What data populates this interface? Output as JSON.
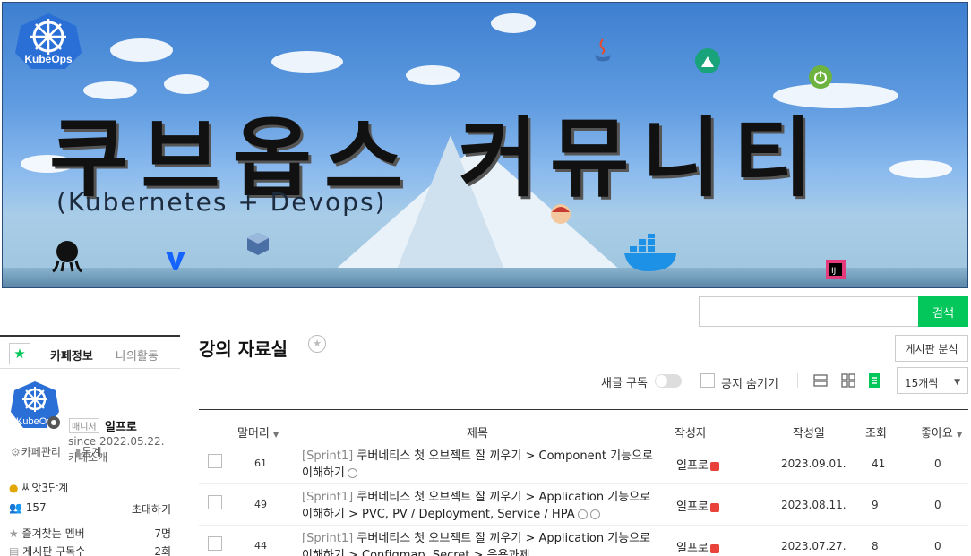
{
  "banner": {
    "logo_text": "KubeOps",
    "title": "쿠브옵스 커뮤니티",
    "subtitle": "(Kubernetes + Devops)"
  },
  "search": {
    "placeholder": "",
    "button": "검색"
  },
  "sidebar": {
    "tab_info": "카페정보",
    "tab_activity": "나의활동",
    "manager_badge": "매니저",
    "manager_name": "일프로",
    "since": "since 2022.05.22.",
    "cafe_intro": "카페소개",
    "cafe_manage": "카페관리",
    "stats_link": "통계",
    "level": "씨앗3단계",
    "members": "157",
    "invite": "초대하기",
    "fav_members_label": "즐겨찾는 멤버",
    "fav_members_value": "7명",
    "board_subs_label": "게시판 구독수",
    "board_subs_value": "2회"
  },
  "main": {
    "board_title": "강의 자료실",
    "analysis_button": "게시판 분석",
    "subscribe_label": "새글 구독",
    "hide_notice_label": "공지 숨기기",
    "per_page": "15개씩",
    "columns": {
      "header": "말머리",
      "title": "제목",
      "author": "작성자",
      "date": "작성일",
      "views": "조회",
      "likes": "좋아요"
    },
    "rows": [
      {
        "num": "61",
        "tag": "[Sprint1]",
        "title": "쿠버네티스 첫 오브젝트 잘 끼우기 > Component 기능으로 이해하기",
        "author": "일프로",
        "date": "2023.09.01.",
        "views": "41",
        "likes": "0"
      },
      {
        "num": "49",
        "tag": "[Sprint1]",
        "title": "쿠버네티스 첫 오브젝트 잘 끼우기 > Application 기능으로 이해하기 > PVC, PV / Deployment, Service / HPA",
        "author": "일프로",
        "date": "2023.08.11.",
        "views": "9",
        "likes": "0"
      },
      {
        "num": "44",
        "tag": "[Sprint1]",
        "title": "쿠버네티스 첫 오브젝트 잘 끼우기 > Application 기능으로 이해하기 > Configmap, Secret > 응용과제",
        "author": "일프로",
        "date": "2023.07.27.",
        "views": "8",
        "likes": "0"
      }
    ]
  },
  "colors": {
    "accent": "#03c75a",
    "banner_border": "#2b4e7a",
    "member_badge": "#e8423a"
  }
}
